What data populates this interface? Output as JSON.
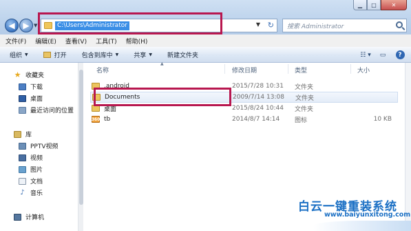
{
  "window": {
    "controls": [
      "minimize",
      "maximize",
      "close"
    ]
  },
  "address_bar": {
    "path": "C:\\Users\\Administrator",
    "refresh_icon": "refresh-icon"
  },
  "search": {
    "placeholder": "搜索 Administrator"
  },
  "menu": [
    "文件(F)",
    "编辑(E)",
    "查看(V)",
    "工具(T)",
    "帮助(H)"
  ],
  "toolbar": {
    "organize": "组织",
    "open": "打开",
    "include_library": "包含到库中",
    "share": "共享",
    "new_folder": "新建文件夹"
  },
  "nav": {
    "favorites": "收藏夹",
    "downloads": "下载",
    "desktop": "桌面",
    "recent": "最近访问的位置",
    "libraries": "库",
    "pptv": "PPTV视频",
    "videos": "视频",
    "pictures": "图片",
    "documents": "文档",
    "music": "音乐",
    "computer": "计算机"
  },
  "columns": {
    "name": "名称",
    "modified": "修改日期",
    "type": "类型",
    "size": "大小"
  },
  "files": [
    {
      "name": ".android",
      "modified": "2015/7/28 10:31",
      "type": "文件夹",
      "size": ""
    },
    {
      "name": "Documents",
      "modified": "2009/7/14 13:08",
      "type": "文件夹",
      "size": ""
    },
    {
      "name": "桌面",
      "modified": "2015/8/24 10:44",
      "type": "文件夹",
      "size": ""
    },
    {
      "name": "tb",
      "modified": "2014/8/7 14:14",
      "type": "图标",
      "size": "10 KB"
    }
  ],
  "watermark": {
    "title": "白云一键重装系统",
    "url": "www.baiyunxitong.com"
  },
  "colors": {
    "highlight_box": "#b8174f",
    "selection": "#3a8ee6",
    "watermark": "#1a6fc4"
  }
}
